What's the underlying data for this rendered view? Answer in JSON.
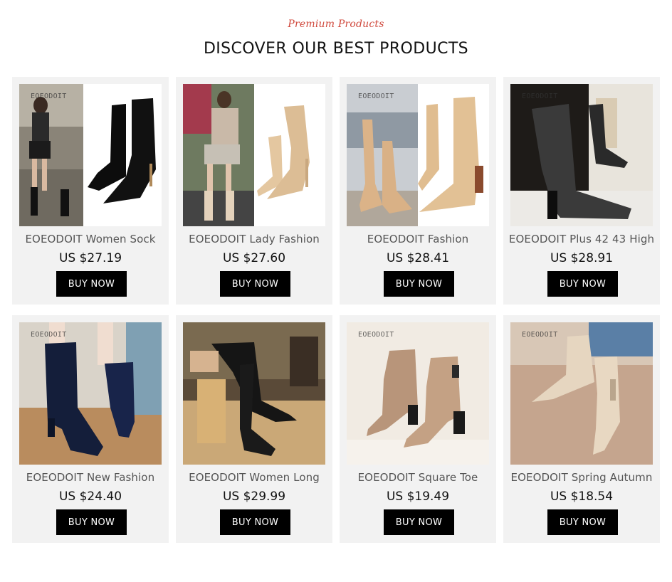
{
  "header": {
    "kicker": "Premium Products",
    "title": "DISCOVER OUR BEST PRODUCTS"
  },
  "colors": {
    "kicker": "#d0493d",
    "card_bg": "#f2f2f2",
    "button_bg": "#000000",
    "button_text": "#ffffff"
  },
  "products": [
    {
      "name": "EOEODOIT Women Sock",
      "price": "US $27.19",
      "button": "BUY NOW",
      "watermark": "EOEODOIT"
    },
    {
      "name": "EOEODOIT Lady Fashion",
      "price": "US $27.60",
      "button": "BUY NOW",
      "watermark": ""
    },
    {
      "name": "EOEODOIT Fashion",
      "price": "US $28.41",
      "button": "BUY NOW",
      "watermark": "EOEODOIT"
    },
    {
      "name": "EOEODOIT Plus 42 43 High",
      "price": "US $28.91",
      "button": "BUY NOW",
      "watermark": "EOEODOIT"
    },
    {
      "name": "EOEODOIT New Fashion",
      "price": "US $24.40",
      "button": "BUY NOW",
      "watermark": "EOEODOIT"
    },
    {
      "name": "EOEODOIT Women Long",
      "price": "US $29.99",
      "button": "BUY NOW",
      "watermark": ""
    },
    {
      "name": "EOEODOIT Square Toe",
      "price": "US $19.49",
      "button": "BUY NOW",
      "watermark": "EOEODOIT"
    },
    {
      "name": "EOEODOIT Spring Autumn",
      "price": "US $18.54",
      "button": "BUY NOW",
      "watermark": "EOEODOIT"
    }
  ]
}
